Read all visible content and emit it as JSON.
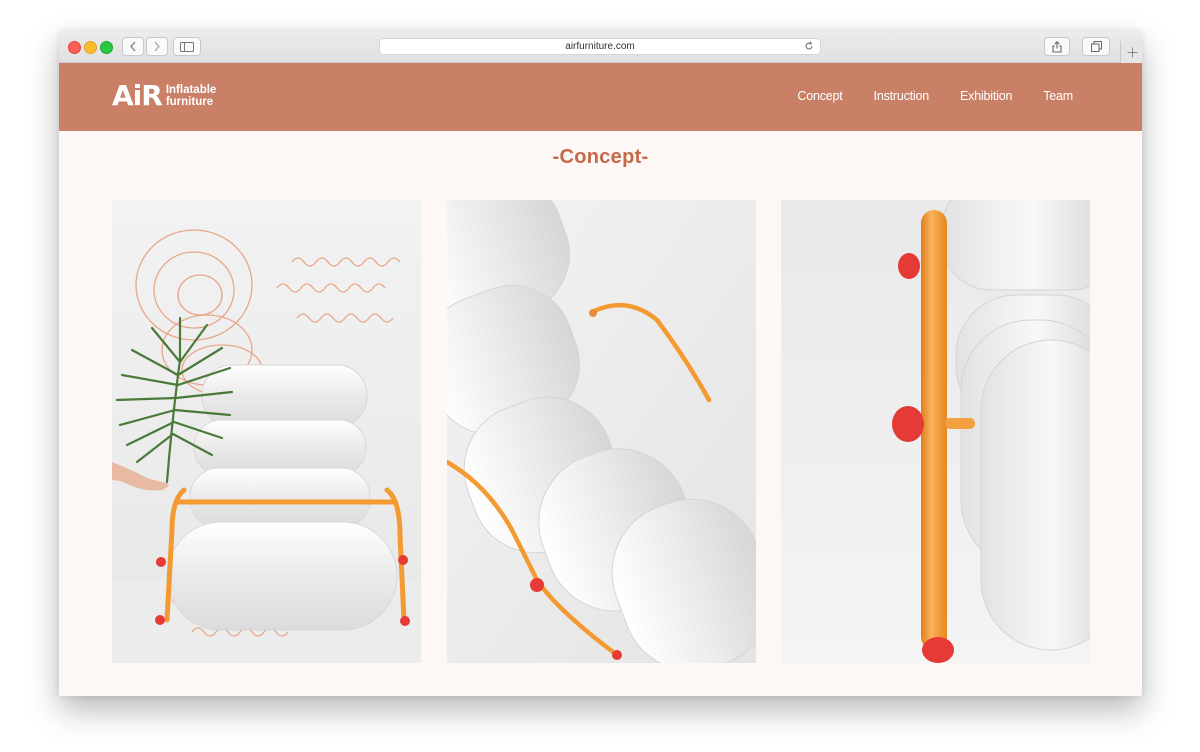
{
  "browser": {
    "url": "airfurniture.com"
  },
  "site": {
    "logo_mark": "AiR",
    "logo_line1": "Inflatable",
    "logo_line2": "furniture",
    "nav": [
      "Concept",
      "Instruction",
      "Exhibition",
      "Team"
    ],
    "section_title": "-Concept-"
  },
  "colors": {
    "header_bg": "#c98066",
    "page_bg": "#fdf8f6",
    "title_color": "#c46a48",
    "frame_orange": "#f39a33",
    "cap_red": "#e53a35"
  },
  "photos": [
    {
      "subject": "inflatable chair with palm leaf and line drawings"
    },
    {
      "subject": "close-up of inflatable cushions and orange tube frame"
    },
    {
      "subject": "side view of orange tube frame with red caps"
    }
  ]
}
